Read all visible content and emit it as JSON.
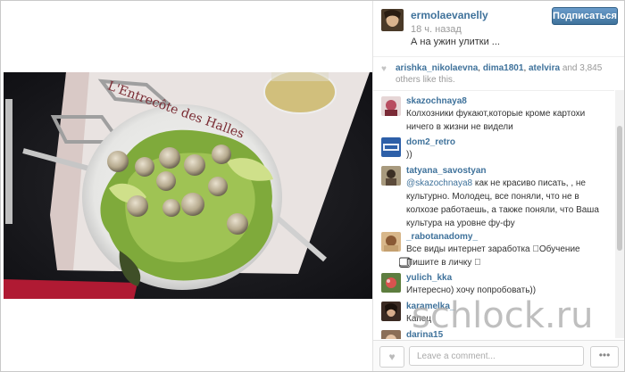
{
  "header": {
    "username": "ermolaevanelly",
    "time": "18 ч. назад",
    "caption": "А на ужин улитки ...",
    "follow_label": "Подписаться"
  },
  "likes": {
    "user1": "arishka_nikolaevna",
    "user2": "dima1801",
    "user3": "atelvira",
    "and": "and",
    "count": "3,845 others",
    "suffix": "like this."
  },
  "comments": [
    {
      "user": "skazochnaya8",
      "text": "Колхозники фукают,которые кроме картохи ничего в жизни не видели"
    },
    {
      "user": "dom2_retro",
      "text": "))"
    },
    {
      "user": "tatyana_savostyan",
      "mention": "@skazochnaya8",
      "text": " как не красиво писать, , не культурно. Молодец, все поняли, что не в колхозе работаешь, а также поняли, что Ваша культура на уровне фу-фу"
    },
    {
      "user": "_rabotanadomy_",
      "text": "Все виды интернет заработка ⃣Обучение ⃣Пишите в личку ⃣"
    },
    {
      "user": "yulich_kka",
      "text": "Интересно) хочу попробовать))"
    },
    {
      "user": "karamelka_",
      "text": "Капец"
    },
    {
      "user": "darina15",
      "text": ""
    }
  ],
  "footer": {
    "comment_placeholder": "Leave a comment...",
    "more_label": "•••"
  },
  "photo": {
    "plate_text": "L'Entrecôte des Halles"
  },
  "watermark": "schlock.ru",
  "colors": {
    "username_blue": "#3f729b",
    "follow_button": "#3f729b"
  }
}
